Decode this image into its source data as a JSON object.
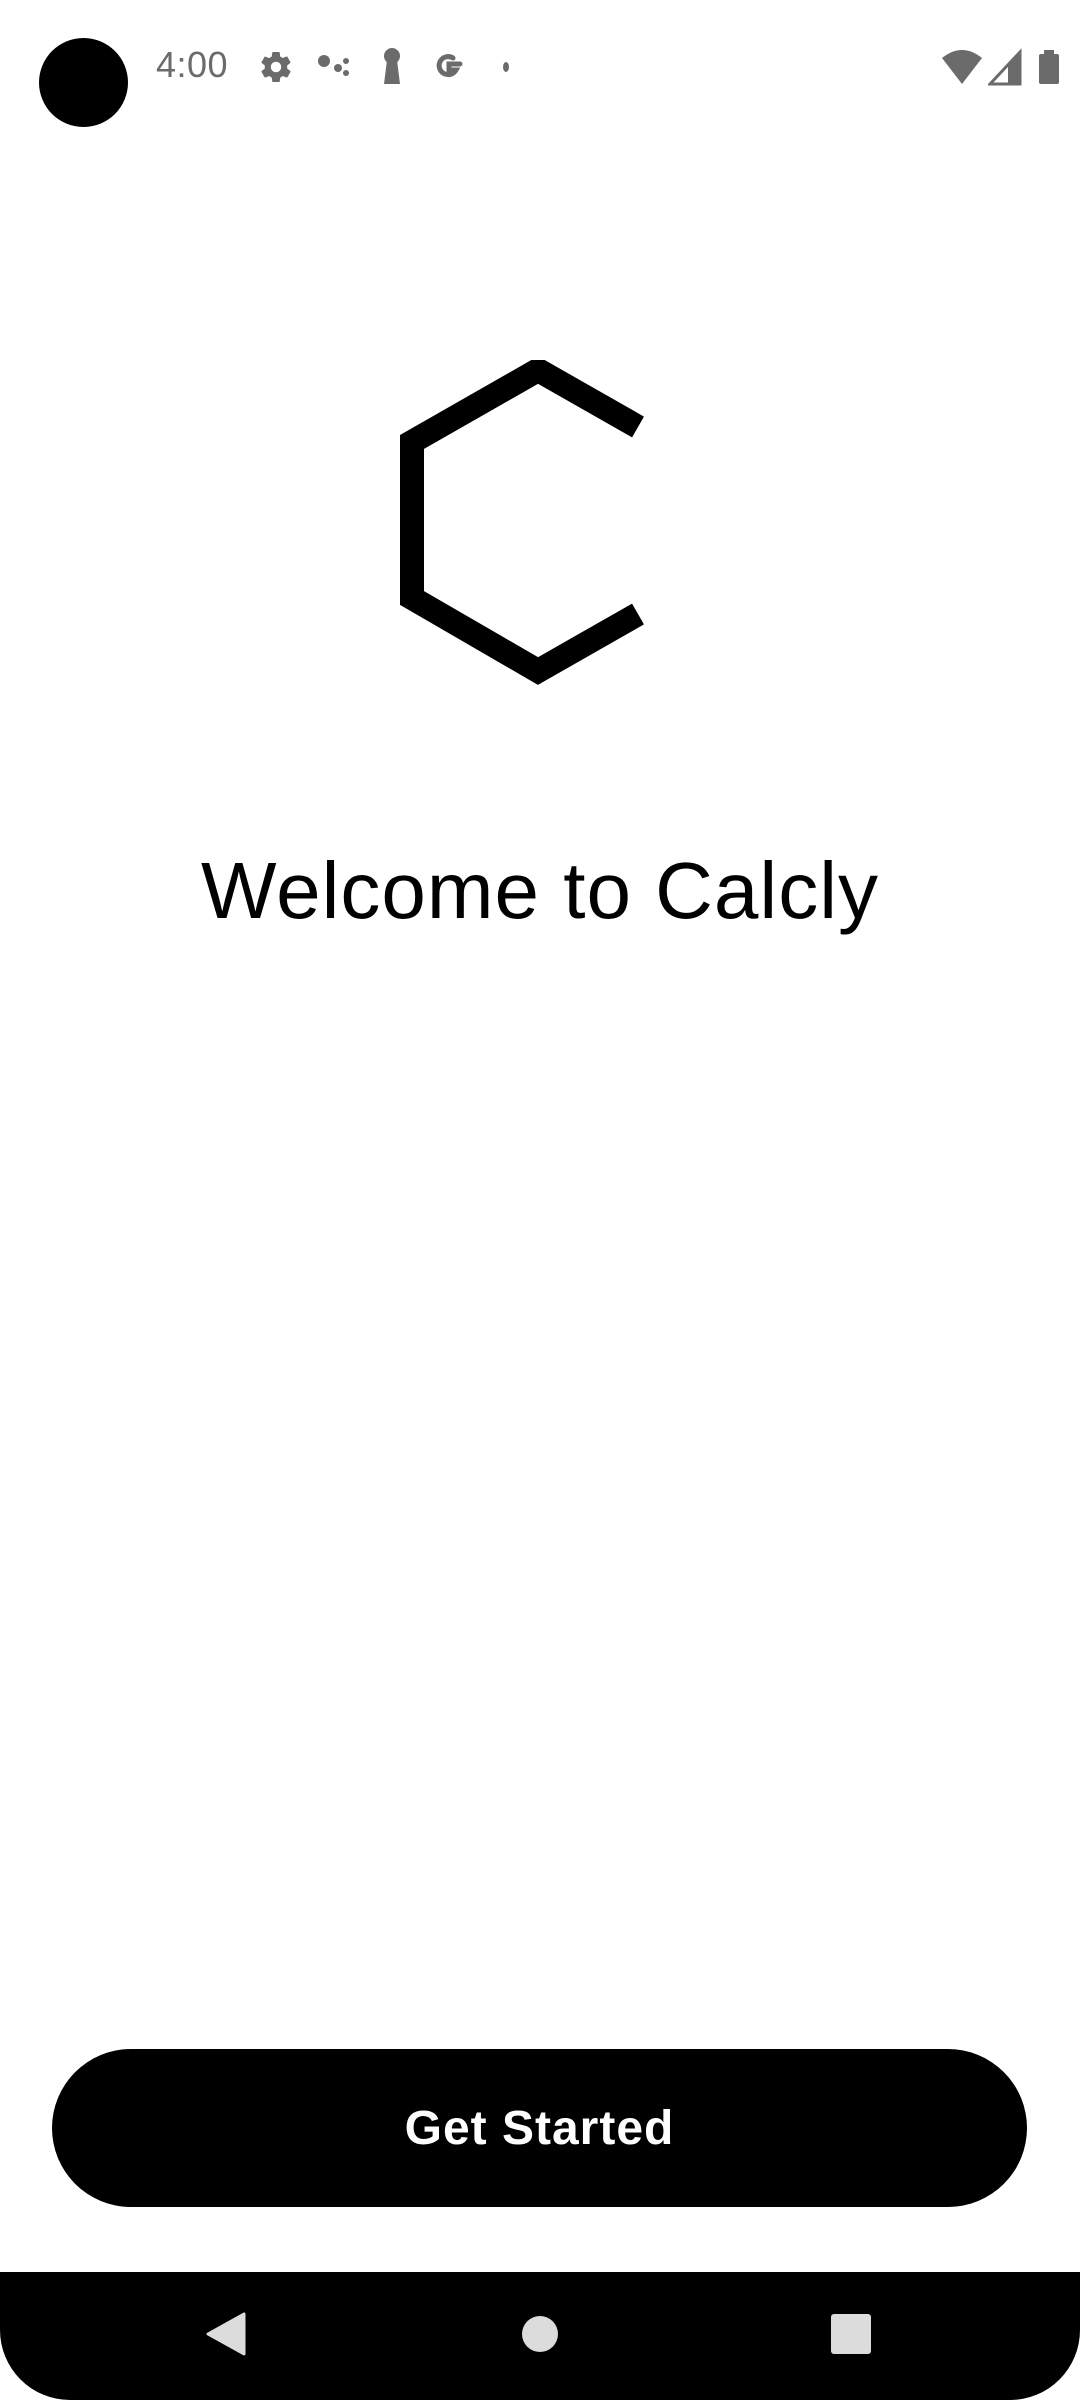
{
  "status_bar": {
    "time": "4:00",
    "left_icons": [
      "settings-icon",
      "assistant-dots-icon",
      "keyhole-icon",
      "google-icon",
      "small-dot-icon"
    ],
    "right_icons": [
      "wifi-icon",
      "cell-signal-icon",
      "battery-icon"
    ]
  },
  "main": {
    "logo": "calcly-hexagon-logo",
    "welcome_text": "Welcome to Calcly"
  },
  "actions": {
    "get_started_label": "Get Started"
  },
  "nav_bar": {
    "buttons": [
      "back-icon",
      "home-icon",
      "recents-icon"
    ]
  },
  "colors": {
    "background": "#ffffff",
    "primary": "#000000",
    "status_text": "#6b6b6b",
    "nav_icons": "#dcdcdc"
  }
}
